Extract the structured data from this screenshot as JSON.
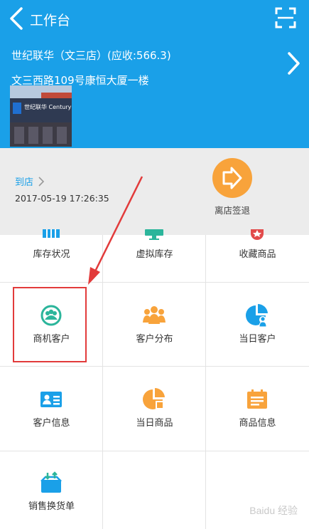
{
  "appbar": {
    "title": "工作台",
    "back_icon": "back-arrow-icon",
    "scan_icon": "scan-icon"
  },
  "store": {
    "name_line": "世纪联华（文三店）(应收:566.3)",
    "address": "文三西路109号康恒大厦一楼",
    "photo_sign": "世纪联华 CenturyMart"
  },
  "checkin": {
    "arrive_label": "到店",
    "arrive_time": "2017-05-19 17:26:35",
    "leave_label": "离店签退"
  },
  "grid": {
    "items": [
      {
        "label": "库存状况",
        "icon": "inventory-status-icon"
      },
      {
        "label": "虚拟库存",
        "icon": "virtual-inventory-icon"
      },
      {
        "label": "收藏商品",
        "icon": "favorites-icon"
      },
      {
        "label": "商机客户",
        "icon": "opportunity-customers-icon"
      },
      {
        "label": "客户分布",
        "icon": "customer-distribution-icon"
      },
      {
        "label": "当日客户",
        "icon": "daily-customers-icon"
      },
      {
        "label": "客户信息",
        "icon": "customer-info-icon"
      },
      {
        "label": "当日商品",
        "icon": "daily-products-icon"
      },
      {
        "label": "商品信息",
        "icon": "product-info-icon"
      },
      {
        "label": "销售换货单",
        "icon": "sales-exchange-icon"
      }
    ]
  },
  "watermark": "Baidu 经验",
  "colors": {
    "primary_blue": "#1aa0e8",
    "orange": "#f8a33b",
    "green": "#2bb59b",
    "red_annotation": "#e23b3b"
  }
}
